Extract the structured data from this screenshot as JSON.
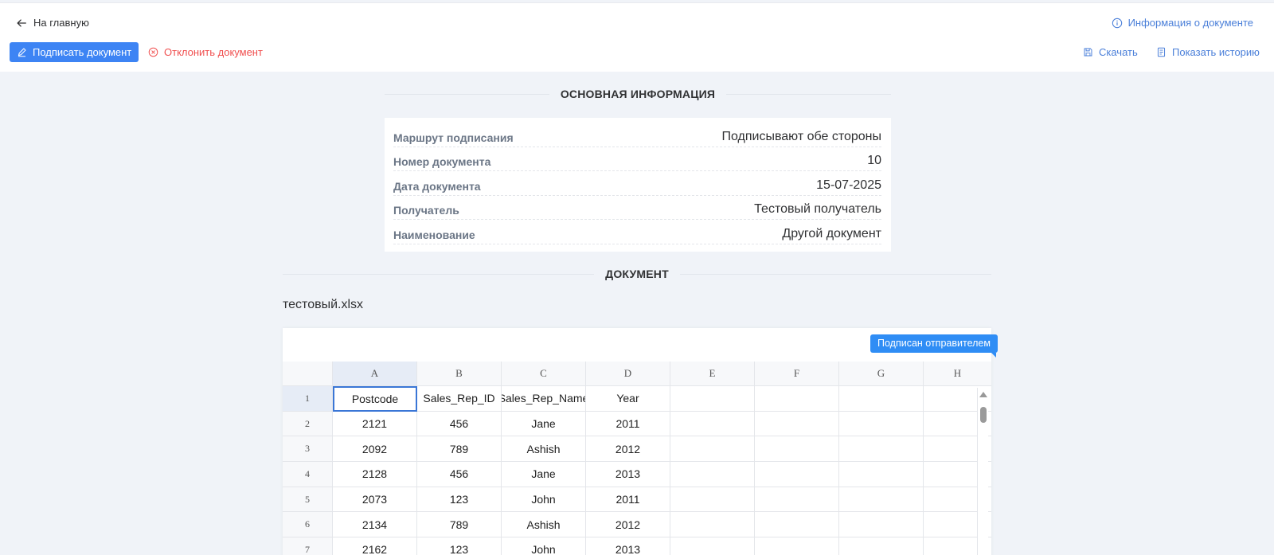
{
  "header": {
    "back_label": "На главную",
    "doc_info_label": "Информация о документе"
  },
  "toolbar": {
    "sign_label": "Подписать документ",
    "reject_label": "Отклонить документ",
    "download_label": "Скачать",
    "history_label": "Показать историю"
  },
  "main_info": {
    "heading": "ОСНОВНАЯ ИНФОРМАЦИЯ",
    "rows": [
      {
        "label": "Маршрут подписания",
        "value": "Подписывают обе стороны"
      },
      {
        "label": "Номер документа",
        "value": "10"
      },
      {
        "label": "Дата документа",
        "value": "15-07-2025"
      },
      {
        "label": "Получатель",
        "value": "Тестовый получатель"
      },
      {
        "label": "Наименование",
        "value": "Другой документ"
      }
    ]
  },
  "document": {
    "heading": "ДОКУМЕНТ",
    "filename": "тестовый.xlsx",
    "badge": "Подписан отправителем"
  },
  "sheet": {
    "columns": [
      "A",
      "B",
      "C",
      "D",
      "E",
      "F",
      "G",
      "H"
    ],
    "rows": [
      {
        "num": "1",
        "cells": [
          "Postcode",
          "Sales_Rep_ID",
          "Sales_Rep_Name",
          "Year",
          "",
          "",
          "",
          ""
        ]
      },
      {
        "num": "2",
        "cells": [
          "2121",
          "456",
          "Jane",
          "2011",
          "",
          "",
          "",
          ""
        ]
      },
      {
        "num": "3",
        "cells": [
          "2092",
          "789",
          "Ashish",
          "2012",
          "",
          "",
          "",
          ""
        ]
      },
      {
        "num": "4",
        "cells": [
          "2128",
          "456",
          "Jane",
          "2013",
          "",
          "",
          "",
          ""
        ]
      },
      {
        "num": "5",
        "cells": [
          "2073",
          "123",
          "John",
          "2011",
          "",
          "",
          "",
          ""
        ]
      },
      {
        "num": "6",
        "cells": [
          "2134",
          "789",
          "Ashish",
          "2012",
          "",
          "",
          "",
          ""
        ]
      },
      {
        "num": "7",
        "cells": [
          "2162",
          "123",
          "John",
          "2013",
          "",
          "",
          "",
          ""
        ]
      }
    ]
  },
  "colors": {
    "primary": "#3d84f4",
    "link": "#4a7fd9",
    "danger": "#f05050",
    "badge": "#2f8df5"
  }
}
